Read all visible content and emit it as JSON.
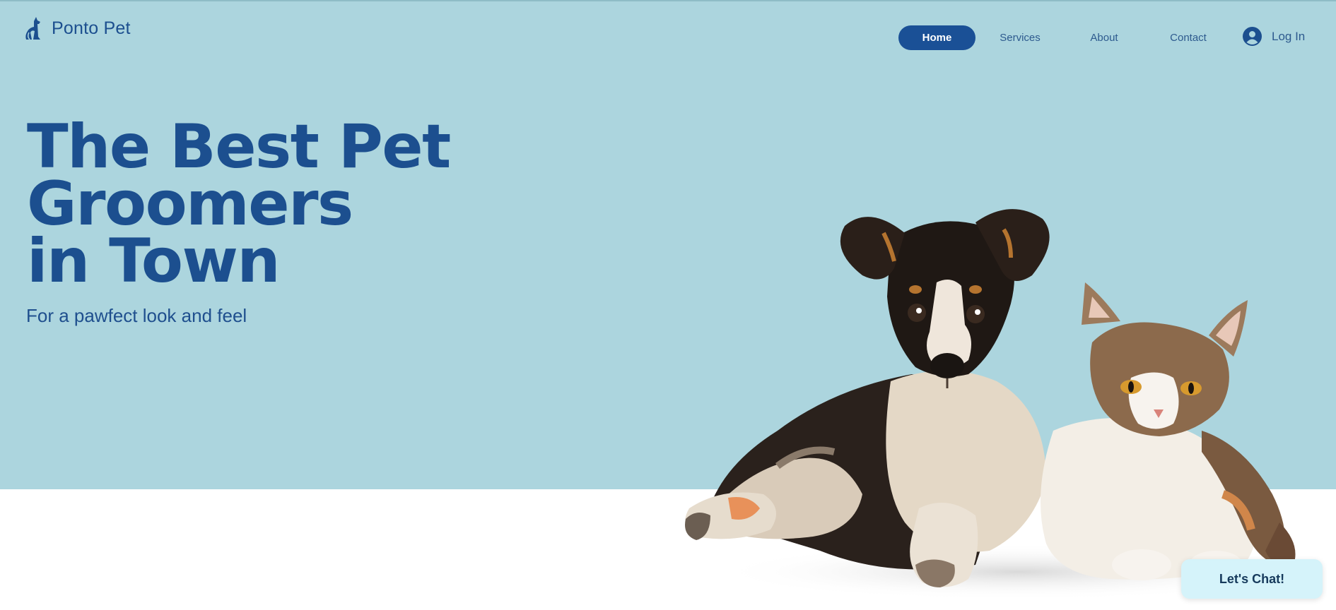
{
  "brand": {
    "name": "Ponto Pet",
    "icon": "dog-cat-logo-icon"
  },
  "nav": {
    "items": [
      {
        "label": "Home",
        "active": true
      },
      {
        "label": "Services",
        "active": false
      },
      {
        "label": "About",
        "active": false
      },
      {
        "label": "Contact",
        "active": false
      }
    ]
  },
  "login": {
    "label": "Log In",
    "icon": "user-avatar-icon"
  },
  "hero": {
    "headline_lines": [
      "The Best Pet",
      "Groomers",
      "in Town"
    ],
    "subheadline": "For a pawfect look and feel"
  },
  "chat": {
    "label": "Let's Chat!"
  },
  "colors": {
    "hero_background": "#acd5de",
    "brand_blue": "#1c4f8f",
    "nav_active": "#1a5096",
    "chat_background": "#d5f3fa"
  }
}
